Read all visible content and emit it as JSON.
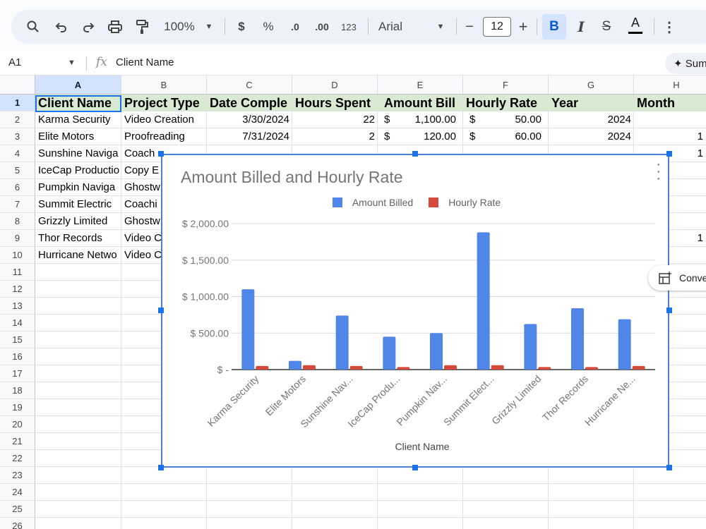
{
  "toolbar": {
    "zoom": "100%",
    "currency": "$",
    "percent": "%",
    "dec_decrease": ".0",
    "dec_increase": ".00",
    "number_format": "123",
    "font": "Arial",
    "font_size": "12",
    "minus": "−",
    "plus": "+",
    "bold": "B",
    "italic": "I",
    "strike": "S",
    "text_color": "A",
    "more": "⋮"
  },
  "formula_bar": {
    "name_box": "A1",
    "fx": "fx",
    "value": "Client Name",
    "summarize_chip": "✦ Sum"
  },
  "grid": {
    "columns": [
      "A",
      "B",
      "C",
      "D",
      "E",
      "F",
      "G",
      "H"
    ],
    "rows": [
      "1",
      "2",
      "3",
      "4",
      "5",
      "6",
      "7",
      "8",
      "9",
      "10",
      "11",
      "12",
      "13",
      "14",
      "15",
      "16",
      "17",
      "18",
      "19",
      "20",
      "21",
      "22",
      "23",
      "24",
      "25",
      "26"
    ],
    "header_cells": [
      "Client Name",
      "Project Type",
      "Date Comple",
      "Hours Spent",
      "Amount Bill",
      "Hourly Rate",
      "Year",
      "Month"
    ],
    "data_rows": [
      {
        "a": "Karma Security",
        "b": "Video Creation",
        "c": "3/30/2024",
        "d": "22",
        "e_sym": "$",
        "e": "1,100.00",
        "f_sym": "$",
        "f": "50.00",
        "g": "2024",
        "h": ""
      },
      {
        "a": "Elite Motors",
        "b": "Proofreading",
        "c": "7/31/2024",
        "d": "2",
        "e_sym": "$",
        "e": "120.00",
        "f_sym": "$",
        "f": "60.00",
        "g": "2024",
        "h": "1"
      },
      {
        "a": "Sunshine Naviga",
        "b": "Coach",
        "c": "",
        "d": "",
        "e_sym": "",
        "e": "",
        "f_sym": "",
        "f": "",
        "g": "",
        "h": "1"
      },
      {
        "a": "IceCap Productio",
        "b": "Copy E",
        "c": "",
        "d": "",
        "e_sym": "",
        "e": "",
        "f_sym": "",
        "f": "",
        "g": "",
        "h": ""
      },
      {
        "a": "Pumpkin Naviga",
        "b": "Ghostw",
        "c": "",
        "d": "",
        "e_sym": "",
        "e": "",
        "f_sym": "",
        "f": "",
        "g": "",
        "h": ""
      },
      {
        "a": "Summit Electric",
        "b": "Coachi",
        "c": "",
        "d": "",
        "e_sym": "",
        "e": "",
        "f_sym": "",
        "f": "",
        "g": "",
        "h": ""
      },
      {
        "a": "Grizzly Limited",
        "b": "Ghostw",
        "c": "",
        "d": "",
        "e_sym": "",
        "e": "",
        "f_sym": "",
        "f": "",
        "g": "",
        "h": ""
      },
      {
        "a": "Thor Records",
        "b": "Video C",
        "c": "",
        "d": "",
        "e_sym": "",
        "e": "",
        "f_sym": "",
        "f": "",
        "g": "",
        "h": "1"
      },
      {
        "a": "Hurricane Netwo",
        "b": "Video C",
        "c": "",
        "d": "",
        "e_sym": "",
        "e": "",
        "f_sym": "",
        "f": "",
        "g": "",
        "h": ""
      }
    ]
  },
  "convert_chip": "Conve",
  "colors": {
    "series1": "#4f86e8",
    "series2": "#d64a3b",
    "header_band": "#d9ead3",
    "selection": "#1a73e8"
  },
  "chart_data": {
    "type": "bar",
    "title": "Amount Billed  and Hourly Rate",
    "xlabel": "Client Name",
    "ylabel": "",
    "categories": [
      "Karma Security",
      "Elite Motors",
      "Sunshine Nav...",
      "IceCap Produ...",
      "Pumpkin Nav...",
      "Summit Elect...",
      "Grizzly Limited",
      "Thor Records",
      "Hurricane Ne..."
    ],
    "series": [
      {
        "name": "Amount Billed",
        "values": [
          1100,
          120,
          740,
          450,
          500,
          1880,
          625,
          840,
          690
        ]
      },
      {
        "name": "Hourly Rate",
        "values": [
          50,
          60,
          50,
          35,
          60,
          60,
          35,
          35,
          50
        ]
      }
    ],
    "ylim": [
      0,
      2000
    ],
    "yticks": [
      0,
      500,
      1000,
      1500,
      2000
    ],
    "ytick_labels": [
      "$ -",
      "$ 500.00",
      "$ 1,000.00",
      "$ 1,500.00",
      "$ 2,000.00"
    ],
    "legend": "top",
    "grid": true
  }
}
